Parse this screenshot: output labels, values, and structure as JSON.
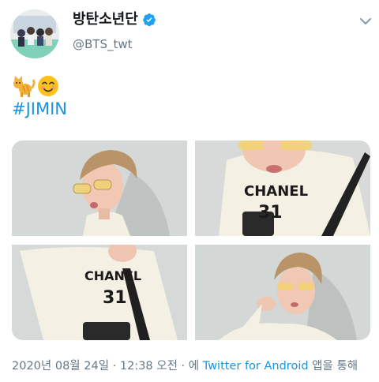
{
  "author": {
    "display_name": "방탄소년단",
    "handle": "@BTS_twt",
    "verified": true
  },
  "tweet": {
    "emojis": [
      "cat-emoji",
      "smiling-face-emoji"
    ],
    "hashtag": "#JIMIN",
    "media_count": 4,
    "chanel_text": "CHANEL",
    "chanel_number": "31"
  },
  "footer": {
    "date_time": "2020년 08월 24일 · 12:38 오전 · 에 ",
    "source": "Twitter for Android",
    "suffix": " 앱을 통해"
  },
  "colors": {
    "link": "#1b95e0",
    "verified": "#1da1f2",
    "muted": "#657786"
  }
}
